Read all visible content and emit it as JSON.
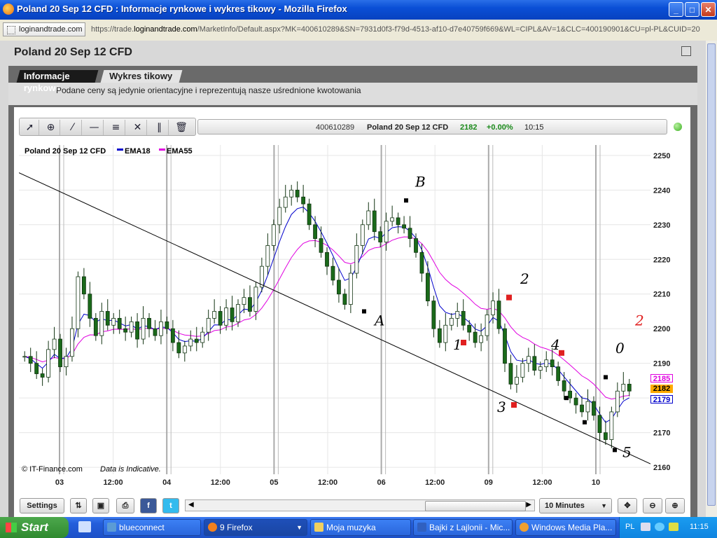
{
  "window": {
    "title": "Poland 20 Sep 12 CFD : Informacje rynkowe i wykres tikowy - Mozilla Firefox",
    "controls": [
      "_",
      "□",
      "✕"
    ]
  },
  "urlbar": {
    "site": "loginandtrade.com",
    "url_prefix": "https://trade.",
    "url_domain": "loginandtrade.com",
    "url_rest": "/MarketInfo/Default.aspx?MK=400610289&SN=7931d0f3-f79d-4513-af10-d7e40759f669&WL=CIPL&AV=1&CLC=400190901&CU=pl-PL&CUID=20"
  },
  "dialog": {
    "title": "Poland 20 Sep 12 CFD",
    "tabs": [
      "Informacje rynkowe",
      "Wykres tikowy"
    ],
    "active_tab": "Wykres tikowy",
    "disclaimer": "Podane ceny są jedynie orientacyjne i reprezentują nasze uśrednione kwotowania"
  },
  "toolbar": {
    "tools": [
      "pointer-icon",
      "zoom-icon",
      "trendline-icon",
      "horizontal-line-icon",
      "fibonacci-icon",
      "crosshair-icon",
      "parallel-lines-icon",
      "trash-icon"
    ]
  },
  "infobar": {
    "market_id": "400610289",
    "name": "Poland 20 Sep 12 CFD",
    "price": "2182",
    "change": "+0.00%",
    "time": "10:15"
  },
  "chart_data": {
    "type": "candlestick",
    "title": "Poland 20 Sep 12 CFD",
    "legend": [
      {
        "name": "EMA18",
        "color": "#0000cc"
      },
      {
        "name": "EMA55",
        "color": "#e000e0"
      }
    ],
    "x_ticks": [
      "03",
      "12:00",
      "04",
      "12:00",
      "05",
      "12:00",
      "06",
      "12:00",
      "09",
      "12:00",
      "10"
    ],
    "y_ticks": [
      2160,
      2170,
      2180,
      2190,
      2200,
      2210,
      2220,
      2230,
      2240,
      2250
    ],
    "ylim": [
      2158,
      2253
    ],
    "last_price_labels": {
      "ema55": "2185",
      "last": "2182",
      "ema18": "2179"
    },
    "grid": "vertical day separators and horizontal price lines",
    "footer_left": "© IT-Finance.com",
    "footer_note": "Data is Indicative.",
    "close_path": [
      2192,
      2190,
      2187,
      2186,
      2194,
      2197,
      2189,
      2192,
      2200,
      2215,
      2210,
      2203,
      2198,
      2205,
      2201,
      2203,
      2200,
      2199,
      2202,
      2197,
      2203,
      2200,
      2198,
      2202,
      2200,
      2196,
      2193,
      2195,
      2197,
      2196,
      2199,
      2203,
      2205,
      2201,
      2206,
      2202,
      2207,
      2209,
      2205,
      2212,
      2218,
      2224,
      2230,
      2235,
      2238,
      2240,
      2238,
      2236,
      2230,
      2226,
      2222,
      2218,
      2214,
      2210,
      2207,
      2216,
      2224,
      2230,
      2234,
      2228,
      2225,
      2231,
      2232,
      2230,
      2229,
      2226,
      2222,
      2216,
      2208,
      2200,
      2196,
      2201,
      2203,
      2205,
      2201,
      2199,
      2196,
      2198,
      2204,
      2208,
      2200,
      2190,
      2184,
      2186,
      2190,
      2192,
      2188,
      2189,
      2191,
      2189,
      2185,
      2182,
      2180,
      2178,
      2176,
      2179,
      2175,
      2170,
      2168,
      2176,
      2182,
      2184,
      2182
    ],
    "annotations_drawn": [
      "B",
      "A",
      "1",
      "2",
      "3",
      "4",
      "5",
      "0",
      "2"
    ],
    "markers": [
      {
        "x": "05 mid",
        "color": "black"
      },
      {
        "x": "06 early",
        "color": "black"
      }
    ]
  },
  "controls": {
    "settings": "Settings",
    "interval": "10 Minutes",
    "bottom_icons": [
      "export-icon",
      "save-icon",
      "print-icon",
      "facebook-icon",
      "twitter-icon"
    ]
  },
  "taskbar": {
    "start": "Start",
    "tasks": [
      {
        "label": "blueconnect",
        "color": "#5b9bd5"
      },
      {
        "label": "9 Firefox",
        "color": "#f08020"
      },
      {
        "label": "Moja muzyka",
        "color": "#f0d060"
      },
      {
        "label": "Bajki z Lajlonii - Mic...",
        "color": "#3060c0"
      },
      {
        "label": "Windows Media Pla...",
        "color": "#f0a030"
      }
    ],
    "lang": "PL",
    "clock": "11:15"
  }
}
